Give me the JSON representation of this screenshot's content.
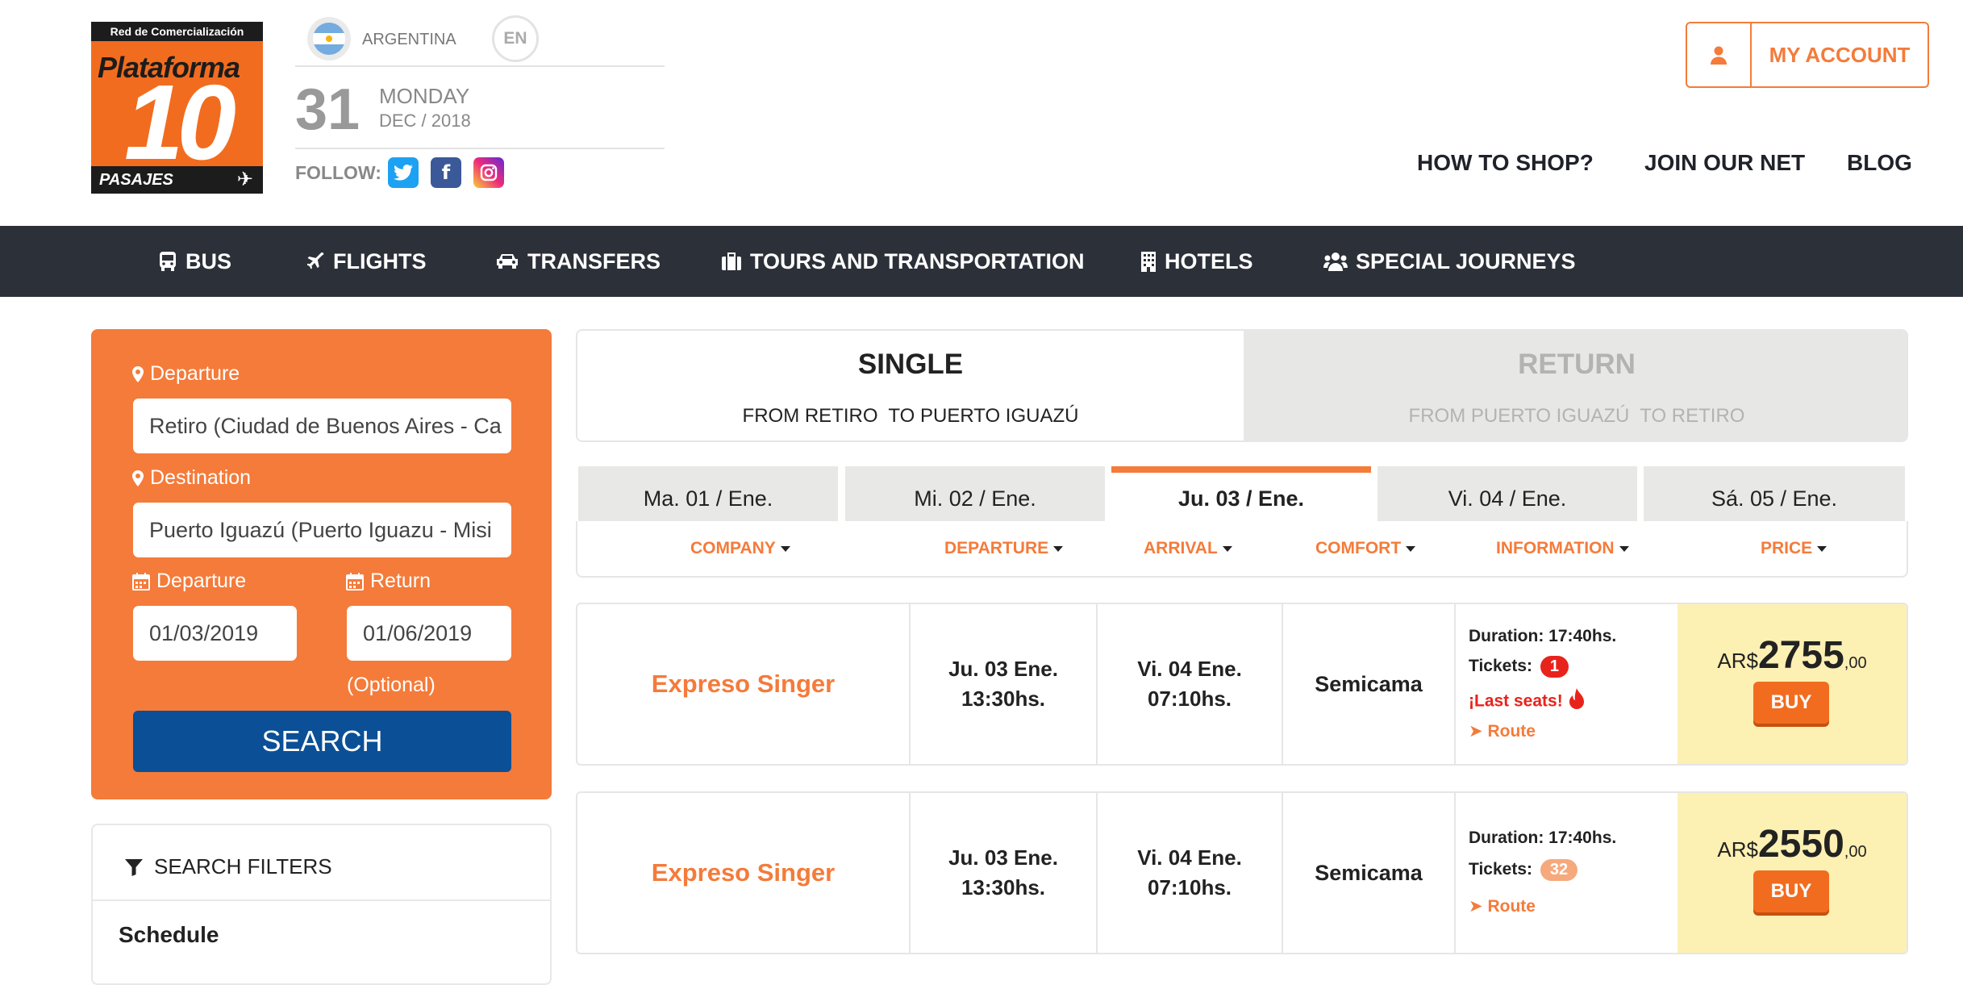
{
  "logo": {
    "top_text": "Red de Comercialización",
    "brand": "Plataforma",
    "number": "10",
    "bottom_text": "PASAJES"
  },
  "header": {
    "country": "ARGENTINA",
    "language": "EN",
    "day_number": "31",
    "day_name": "MONDAY",
    "month_year": "DEC / 2018",
    "follow_label": "FOLLOW:",
    "account_label": "MY ACCOUNT",
    "links": [
      "HOW TO SHOP?",
      "JOIN OUR NET",
      "BLOG"
    ]
  },
  "nav": {
    "items": [
      {
        "label": "BUS",
        "icon": "bus-icon"
      },
      {
        "label": "FLIGHTS",
        "icon": "plane-icon"
      },
      {
        "label": "TRANSFERS",
        "icon": "car-icon"
      },
      {
        "label": "TOURS AND TRANSPORTATION",
        "icon": "suitcase-icon"
      },
      {
        "label": "HOTELS",
        "icon": "building-icon"
      },
      {
        "label": "SPECIAL JOURNEYS",
        "icon": "group-icon"
      }
    ]
  },
  "search": {
    "departure_label": "Departure",
    "departure_value": "Retiro (Ciudad de Buenos Aires - Ca",
    "destination_label": "Destination",
    "destination_value": "Puerto Iguazú (Puerto Iguazu - Misi",
    "date_departure_label": "Departure",
    "date_departure_value": "01/03/2019",
    "date_return_label": "Return",
    "date_return_value": "01/06/2019",
    "optional_label": "(Optional)",
    "button": "SEARCH"
  },
  "filters": {
    "title": "SEARCH FILTERS",
    "schedule": "Schedule"
  },
  "trip": {
    "single_title": "SINGLE",
    "single_route": "FROM RETIRO  TO PUERTO IGUAZÚ",
    "return_title": "RETURN",
    "return_route": "FROM PUERTO IGUAZÚ  TO RETIRO"
  },
  "dates": {
    "tabs": [
      "Ma. 01 / Ene.",
      "Mi. 02 / Ene.",
      "Ju. 03 / Ene.",
      "Vi. 04 / Ene.",
      "Sá. 05 / Ene."
    ],
    "active_index": 2
  },
  "columns": [
    "COMPANY",
    "DEPARTURE",
    "ARRIVAL",
    "COMFORT",
    "INFORMATION",
    "PRICE"
  ],
  "results": [
    {
      "company": "Expreso Singer",
      "departure_day": "Ju. 03 Ene.",
      "departure_time": "13:30hs.",
      "arrival_day": "Vi. 04 Ene.",
      "arrival_time": "07:10hs.",
      "comfort": "Semicama",
      "duration": "Duration: 17:40hs.",
      "tickets_label": "Tickets:",
      "tickets": "1",
      "tickets_color": "#e8231c",
      "last_seats": "¡Last seats!",
      "route": "Route",
      "currency": "AR$",
      "price": "2755",
      "cents": ",00",
      "buy": "BUY"
    },
    {
      "company": "Expreso Singer",
      "departure_day": "Ju. 03 Ene.",
      "departure_time": "13:30hs.",
      "arrival_day": "Vi. 04 Ene.",
      "arrival_time": "07:10hs.",
      "comfort": "Semicama",
      "duration": "Duration: 17:40hs.",
      "tickets_label": "Tickets:",
      "tickets": "32",
      "tickets_color": "#f6a97d",
      "route": "Route",
      "currency": "AR$",
      "price": "2550",
      "cents": ",00",
      "buy": "BUY"
    }
  ],
  "colors": {
    "accent": "#f47b3a",
    "nav_bg": "#2c3038",
    "search_button": "#0b4f96",
    "price_bg": "#fdf0b3"
  }
}
